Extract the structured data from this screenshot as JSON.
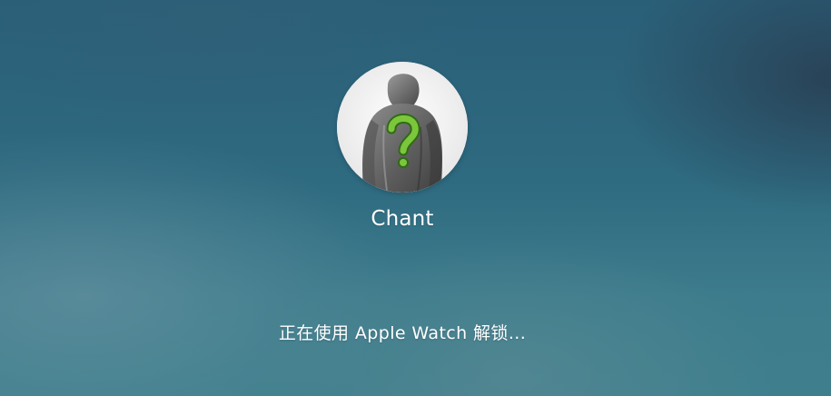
{
  "user": {
    "name": "Chant",
    "avatar_icon": "question-mark-figure-avatar"
  },
  "unlock": {
    "status_text": "正在使用 Apple Watch 解锁..."
  },
  "colors": {
    "background_top": "#2a5f78",
    "background_bottom": "#3f7f8d",
    "text": "#ffffff",
    "avatar_question_mark": "#7cc63c"
  }
}
